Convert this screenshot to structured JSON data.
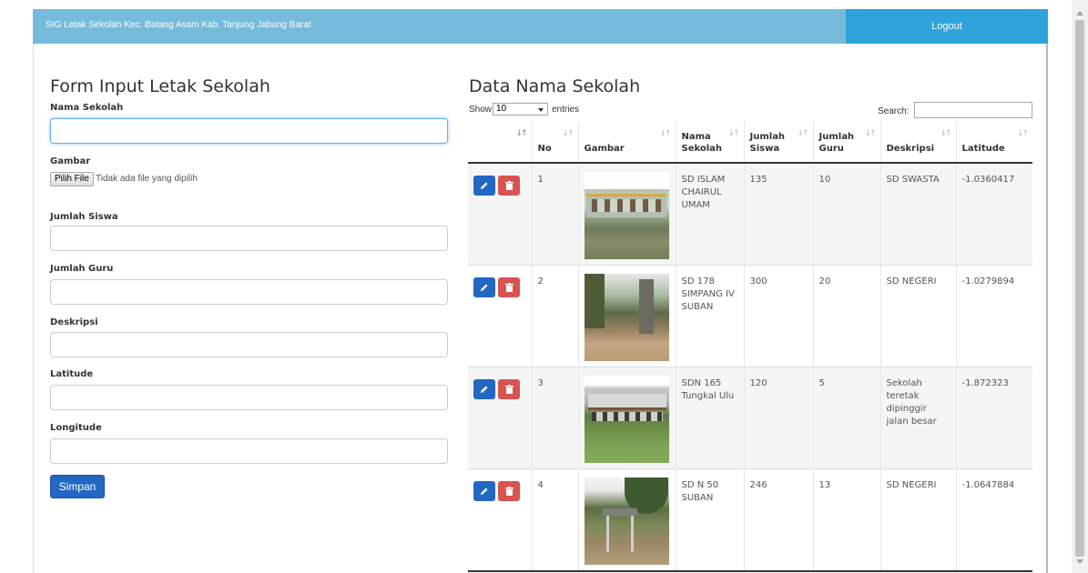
{
  "navbar": {
    "brand": "SIG Letak Sekolah Kec. Batang Asam Kab. Tanjung Jabung Barat",
    "logout_label": "Logout"
  },
  "form": {
    "title": "Form Input Letak Sekolah",
    "nama_label": "Nama Sekolah",
    "gambar_label": "Gambar",
    "file_button": "Pilih File",
    "file_status": "Tidak ada file yang dipilih",
    "siswa_label": "Jumlah Siswa",
    "guru_label": "Jumlah Guru",
    "deskripsi_label": "Deskripsi",
    "latitude_label": "Latitude",
    "longitude_label": "Longitude",
    "save_label": "Simpan"
  },
  "data_section": {
    "title": "Data Nama Sekolah",
    "show_label": "Show",
    "show_value": "10",
    "entries_label": "entries",
    "search_label": "Search:"
  },
  "table": {
    "headers": [
      "",
      "No",
      "Gambar",
      "Nama Sekolah",
      "Jumlah Siswa",
      "Jumlah Guru",
      "Deskripsi",
      "Latitude"
    ],
    "rows": [
      {
        "no": "1",
        "nama": "SD ISLAM CHAIRUL UMAM",
        "siswa": "135",
        "guru": "10",
        "deskripsi": "SD SWASTA",
        "latitude": "-1.0360417"
      },
      {
        "no": "2",
        "nama": "SD 178 SIMPANG IV SUBAN",
        "siswa": "300",
        "guru": "20",
        "deskripsi": "SD NEGERI",
        "latitude": "-1.0279894"
      },
      {
        "no": "3",
        "nama": "SDN 165 Tungkal Ulu",
        "siswa": "120",
        "guru": "5",
        "deskripsi": "Sekolah teretak dipinggir jalan besar",
        "latitude": "-1.872323"
      },
      {
        "no": "4",
        "nama": "SD N 50 SUBAN",
        "siswa": "246",
        "guru": "13",
        "deskripsi": "SD NEGERI",
        "latitude": "-1.0647884"
      }
    ]
  },
  "colors": {
    "navbar": "#76bbdc",
    "logout": "#2ea3dc",
    "primary": "#2267c2",
    "danger": "#d9534f"
  },
  "icons": {
    "edit": "pencil-icon",
    "delete": "trash-icon",
    "sort": "sort-icon"
  }
}
